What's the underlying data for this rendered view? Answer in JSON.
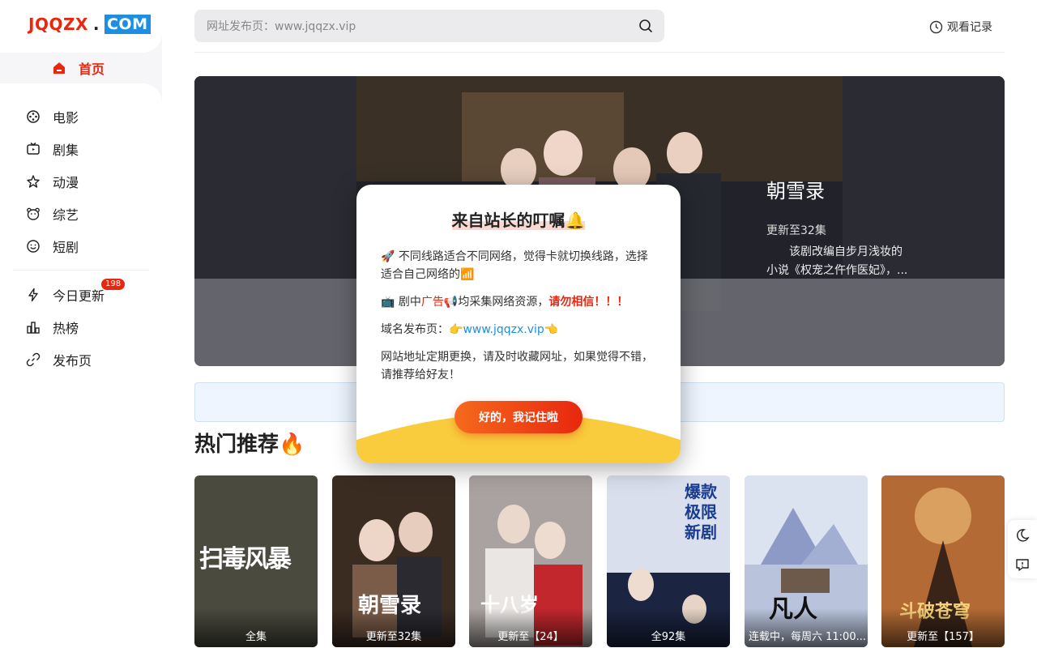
{
  "logo": {
    "part1": "JQQZX",
    "dot": ".",
    "part2": "COM"
  },
  "sidebar": {
    "home": {
      "label": "首页"
    },
    "items": [
      {
        "label": "电影"
      },
      {
        "label": "剧集"
      },
      {
        "label": "动漫"
      },
      {
        "label": "综艺"
      },
      {
        "label": "短剧"
      }
    ],
    "extras": [
      {
        "label": "今日更新",
        "badge": "198"
      },
      {
        "label": "热榜"
      },
      {
        "label": "发布页"
      }
    ]
  },
  "search": {
    "placeholder": "网址发布页：www.jqqzx.vip"
  },
  "header": {
    "history_label": "观看记录"
  },
  "banner": {
    "title": "朝雪录",
    "status": "更新至32集",
    "description": "该剧改编自步月浅妆的小说《权宠之仵作医妃》，..."
  },
  "section": {
    "title": "热门推荐🔥"
  },
  "cards": [
    {
      "caption": "全集",
      "poster_text": "扫毒风暴",
      "color": "#4a4a3e"
    },
    {
      "caption": "更新至32集",
      "poster_text": "朝雪录",
      "color": "#3b2c22"
    },
    {
      "caption": "更新至【24】",
      "poster_text": "十八岁",
      "color": "#8b7a70"
    },
    {
      "caption": "全92集",
      "poster_text": "爆款极限新剧",
      "color": "#cfd6e6"
    },
    {
      "caption": "连载中，每周六 11:00...",
      "poster_text": "凡人",
      "color": "#c8d4e8"
    },
    {
      "caption": "更新至【157】",
      "poster_text": "斗破苍穹",
      "color": "#8a4a26"
    }
  ],
  "modal": {
    "title": "来自站长的叮嘱🔔",
    "p1": "🚀 不同线路适合不同网络，觉得卡就切换线路，选择适合自己网络的📶",
    "p2_prefix": "📺 剧中",
    "p2_ad": "广告📢",
    "p2_mid": "均采集网络资源，",
    "p2_warn": "请勿相信！！！",
    "p3_prefix": "域名发布页：👉",
    "p3_link": "www.jqqzx.vip",
    "p3_suffix": "👈",
    "p4": "网站地址定期更换，请及时收藏网址，如果觉得不错，请推荐给好友！",
    "button": "好的，我记住啦"
  }
}
